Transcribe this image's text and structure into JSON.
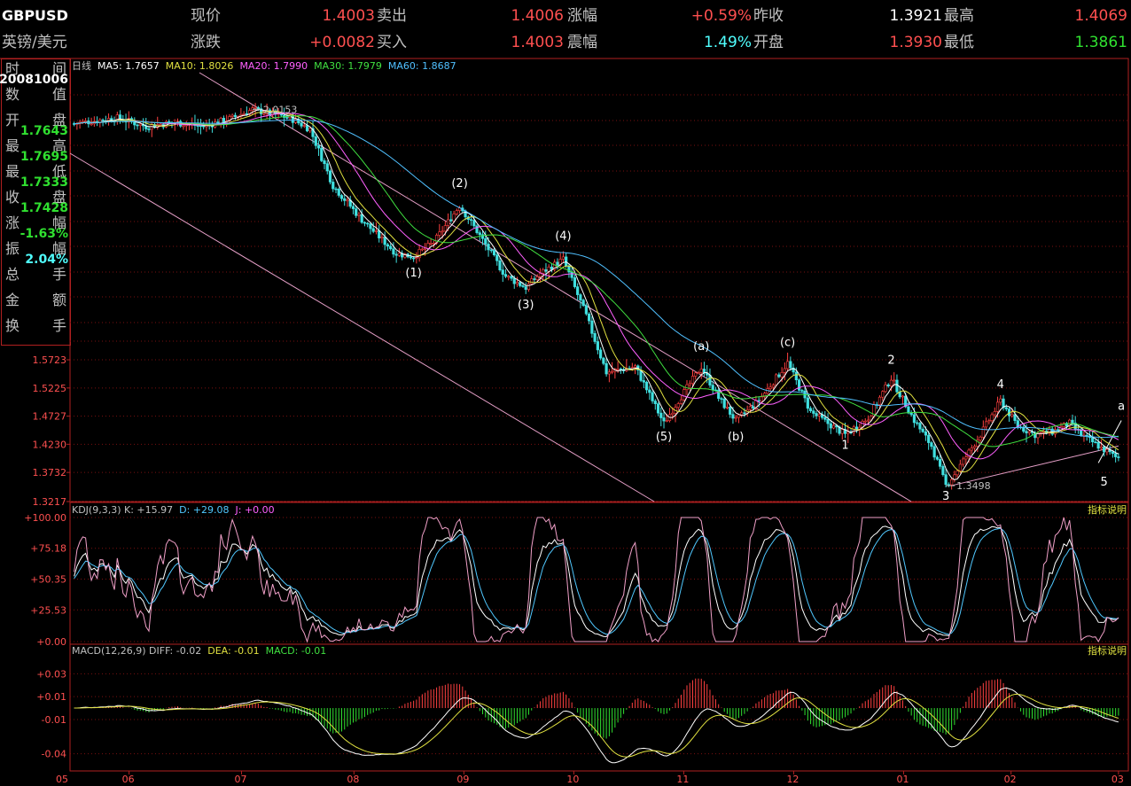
{
  "header": {
    "symbol": "GBPUSD",
    "name": "英镑/美元",
    "rows": [
      [
        {
          "label": "现价",
          "value": "1.4003",
          "color": "red"
        },
        {
          "label": "卖出",
          "value": "1.4006",
          "color": "red"
        },
        {
          "label": "涨幅",
          "value": "+0.59%",
          "color": "red"
        },
        {
          "label": "昨收",
          "value": "1.3921",
          "color": "wht"
        },
        {
          "label": "最高",
          "value": "1.4069",
          "color": "red"
        }
      ],
      [
        {
          "label": "涨跌",
          "value": "+0.0082",
          "color": "red"
        },
        {
          "label": "买入",
          "value": "1.4003",
          "color": "red"
        },
        {
          "label": "震幅",
          "value": "1.49%",
          "color": "cyn"
        },
        {
          "label": "开盘",
          "value": "1.3930",
          "color": "red"
        },
        {
          "label": "最低",
          "value": "1.3861",
          "color": "grn"
        }
      ]
    ]
  },
  "info_panel": {
    "rows": [
      {
        "left": "时",
        "right": "间",
        "value": "20081006",
        "color": "#ffffff"
      },
      {
        "left": "数",
        "right": "值",
        "value": "",
        "color": "#ffffff"
      },
      {
        "left": "开",
        "right": "盘",
        "value": "1.7643",
        "color": "#30e030"
      },
      {
        "left": "最",
        "right": "高",
        "value": "1.7695",
        "color": "#30e030"
      },
      {
        "left": "最",
        "right": "低",
        "value": "1.7333",
        "color": "#30e030"
      },
      {
        "left": "收",
        "right": "盘",
        "value": "1.7428",
        "color": "#30e030"
      },
      {
        "left": "涨",
        "right": "幅",
        "value": "-1.63%",
        "color": "#30e030"
      },
      {
        "left": "振",
        "right": "幅",
        "value": "2.04%",
        "color": "#50ffff"
      },
      {
        "left": "总",
        "right": "手",
        "value": "",
        "color": "#ffffff"
      },
      {
        "left": "金",
        "right": "额",
        "value": "",
        "color": "#ffffff"
      },
      {
        "left": "换",
        "right": "手",
        "value": "",
        "color": "#ffffff"
      }
    ]
  },
  "main_legend": [
    {
      "text": "日线",
      "color": "#c0c0c0"
    },
    {
      "text": "MA5: 1.7657",
      "color": "#ffffff"
    },
    {
      "text": "MA10: 1.8026",
      "color": "#e0e040"
    },
    {
      "text": "MA20: 1.7990",
      "color": "#ff60ff"
    },
    {
      "text": "MA30: 1.7979",
      "color": "#40e040"
    },
    {
      "text": "MA60: 1.8687",
      "color": "#50c0ff"
    }
  ],
  "kdj_legend": [
    {
      "text": "KDJ(9,3,3) K: +15.97",
      "color": "#c0c0c0"
    },
    {
      "text": "D: +29.08",
      "color": "#50c8ff"
    },
    {
      "text": "J: +0.00",
      "color": "#ff60ff"
    }
  ],
  "macd_legend": [
    {
      "text": "MACD(12,26,9) DIFF: -0.02",
      "color": "#c0c0c0"
    },
    {
      "text": "DEA: -0.01",
      "color": "#e0e040"
    },
    {
      "text": "MACD: -0.01",
      "color": "#40e040"
    }
  ],
  "indicator_button": "指标说明",
  "chart_data": {
    "type": "candlestick",
    "symbol": "GBPUSD",
    "period": "日线",
    "x_month_labels": [
      "05",
      "06",
      "07",
      "08",
      "09",
      "10",
      "11",
      "12",
      "01",
      "02",
      "03"
    ],
    "price_axis": {
      "ticks": [
        "1.5723",
        "1.5225",
        "1.4727",
        "1.4230",
        "1.3732",
        "1.3217"
      ],
      "ylim": [
        1.3217,
        2.08
      ]
    },
    "path_keyframes": [
      {
        "t": 0,
        "price": 1.99
      },
      {
        "t": 15,
        "price": 2.0
      },
      {
        "t": 25,
        "price": 1.985
      },
      {
        "t": 35,
        "price": 1.992
      },
      {
        "t": 45,
        "price": 1.985
      },
      {
        "t": 55,
        "price": 2.0
      },
      {
        "t": 62,
        "price": 2.015
      },
      {
        "t": 75,
        "price": 2.0
      },
      {
        "t": 82,
        "price": 1.98
      },
      {
        "t": 90,
        "price": 1.88
      },
      {
        "t": 100,
        "price": 1.82
      },
      {
        "t": 112,
        "price": 1.76
      },
      {
        "t": 118,
        "price": 1.755
      },
      {
        "t": 125,
        "price": 1.78
      },
      {
        "t": 134,
        "price": 1.845
      },
      {
        "t": 140,
        "price": 1.8
      },
      {
        "t": 150,
        "price": 1.72
      },
      {
        "t": 157,
        "price": 1.7
      },
      {
        "t": 162,
        "price": 1.725
      },
      {
        "t": 170,
        "price": 1.75
      },
      {
        "t": 178,
        "price": 1.65
      },
      {
        "t": 185,
        "price": 1.55
      },
      {
        "t": 195,
        "price": 1.56
      },
      {
        "t": 205,
        "price": 1.46
      },
      {
        "t": 210,
        "price": 1.5
      },
      {
        "t": 218,
        "price": 1.56
      },
      {
        "t": 224,
        "price": 1.505
      },
      {
        "t": 230,
        "price": 1.465
      },
      {
        "t": 238,
        "price": 1.5
      },
      {
        "t": 248,
        "price": 1.567
      },
      {
        "t": 256,
        "price": 1.48
      },
      {
        "t": 262,
        "price": 1.46
      },
      {
        "t": 268,
        "price": 1.44
      },
      {
        "t": 276,
        "price": 1.47
      },
      {
        "t": 284,
        "price": 1.54
      },
      {
        "t": 292,
        "price": 1.465
      },
      {
        "t": 298,
        "price": 1.42
      },
      {
        "t": 303,
        "price": 1.35
      },
      {
        "t": 306,
        "price": 1.37
      },
      {
        "t": 315,
        "price": 1.44
      },
      {
        "t": 322,
        "price": 1.5
      },
      {
        "t": 328,
        "price": 1.455
      },
      {
        "t": 334,
        "price": 1.44
      },
      {
        "t": 340,
        "price": 1.445
      },
      {
        "t": 346,
        "price": 1.46
      },
      {
        "t": 350,
        "price": 1.44
      },
      {
        "t": 356,
        "price": 1.42
      },
      {
        "t": 362,
        "price": 1.4
      }
    ],
    "annotations": [
      {
        "label": "2.0153",
        "t": 62,
        "price": 2.0153
      },
      {
        "label": "1.3498",
        "t": 303,
        "price": 1.3498
      },
      {
        "label": "(1)",
        "t": 118,
        "price": 1.72
      },
      {
        "label": "(2)",
        "t": 134,
        "price": 1.878
      },
      {
        "label": "(3)",
        "t": 157,
        "price": 1.663
      },
      {
        "label": "(4)",
        "t": 170,
        "price": 1.785
      },
      {
        "label": "(5)",
        "t": 205,
        "price": 1.43
      },
      {
        "label": "(a)",
        "t": 218,
        "price": 1.59
      },
      {
        "label": "(b)",
        "t": 230,
        "price": 1.43
      },
      {
        "label": "(c)",
        "t": 248,
        "price": 1.597
      },
      {
        "label": "1",
        "t": 268,
        "price": 1.415
      },
      {
        "label": "2",
        "t": 284,
        "price": 1.565
      },
      {
        "label": "3",
        "t": 303,
        "price": 1.325
      },
      {
        "label": "4",
        "t": 322,
        "price": 1.522
      },
      {
        "label": "5",
        "t": 358,
        "price": 1.35
      },
      {
        "label": "a",
        "t": 364,
        "price": 1.484
      }
    ],
    "kdj_axis": {
      "ticks": [
        "+100.00",
        "+75.18",
        "+50.35",
        "+25.53",
        "+0.00"
      ],
      "ylim": [
        0,
        100
      ]
    },
    "macd_axis": {
      "ticks": [
        "+0.03",
        "+0.01",
        "-0.01",
        "-0.04"
      ],
      "ylim": [
        -0.055,
        0.045
      ]
    }
  }
}
